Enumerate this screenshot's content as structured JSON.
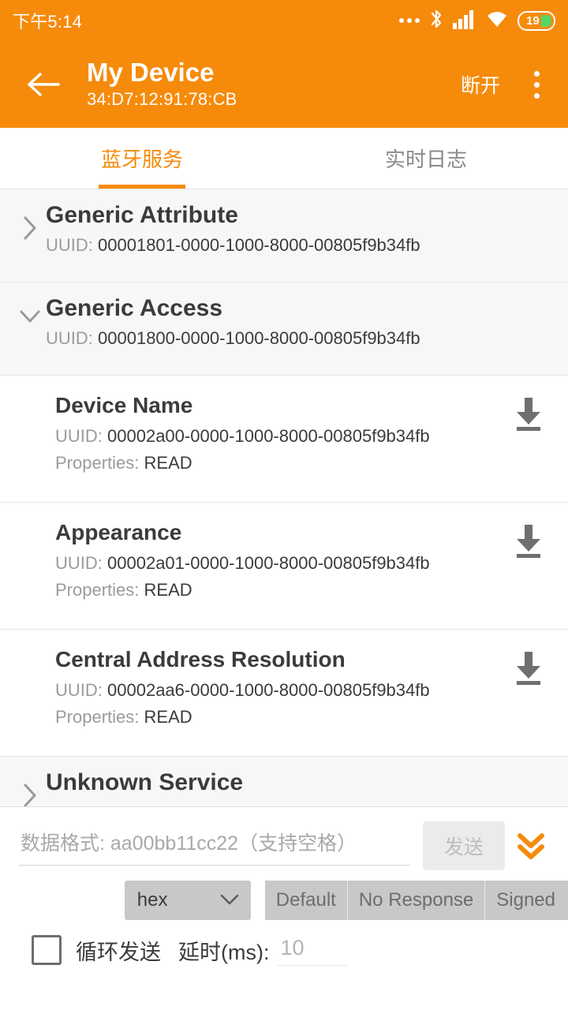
{
  "statusbar": {
    "time": "下午5:14",
    "battery_level": "19",
    "icons": [
      "more-dots-icon",
      "bluetooth-icon",
      "cellular-signal-icon",
      "wifi-icon",
      "battery-icon"
    ]
  },
  "appbar": {
    "back_icon": "back-arrow-icon",
    "device_name": "My Device",
    "device_mac": "34:D7:12:91:78:CB",
    "disconnect_label": "断开",
    "overflow_icon": "overflow-menu-icon",
    "accent_color": "#F68B0B"
  },
  "tabs": [
    {
      "label": "蓝牙服务",
      "active": true
    },
    {
      "label": "实时日志",
      "active": false
    }
  ],
  "list": {
    "uuid_label": "UUID:",
    "properties_label": "Properties:",
    "services": [
      {
        "name": "Generic Attribute",
        "uuid": "00001801-0000-1000-8000-00805f9b34fb",
        "expanded": false,
        "chevron": "chevron-right-icon",
        "characteristics": []
      },
      {
        "name": "Generic Access",
        "uuid": "00001800-0000-1000-8000-00805f9b34fb",
        "expanded": true,
        "chevron": "chevron-down-icon",
        "characteristics": [
          {
            "name": "Device Name",
            "uuid": "00002a00-0000-1000-8000-00805f9b34fb",
            "properties": "READ",
            "action_icon": "download-read-icon"
          },
          {
            "name": "Appearance",
            "uuid": "00002a01-0000-1000-8000-00805f9b34fb",
            "properties": "READ",
            "action_icon": "download-read-icon"
          },
          {
            "name": "Central Address Resolution",
            "uuid": "00002aa6-0000-1000-8000-00805f9b34fb",
            "properties": "READ",
            "action_icon": "download-read-icon"
          }
        ]
      },
      {
        "name": "Unknown Service",
        "uuid": "",
        "expanded": false,
        "chevron": "chevron-right-icon",
        "characteristics": []
      }
    ]
  },
  "bottom_panel": {
    "data_input_value": "",
    "data_input_placeholder": "数据格式: aa00bb11cc22（支持空格）",
    "send_label": "发送",
    "collapse_icon": "double-chevron-down-icon",
    "format_selected": "hex",
    "format_chevron": "chevron-down-icon",
    "write_modes": [
      "Default",
      "No Response",
      "Signed"
    ],
    "loop_checkbox_checked": false,
    "loop_label": "循环发送",
    "delay_label": "延时(ms):",
    "delay_value": "",
    "delay_placeholder": "10"
  }
}
